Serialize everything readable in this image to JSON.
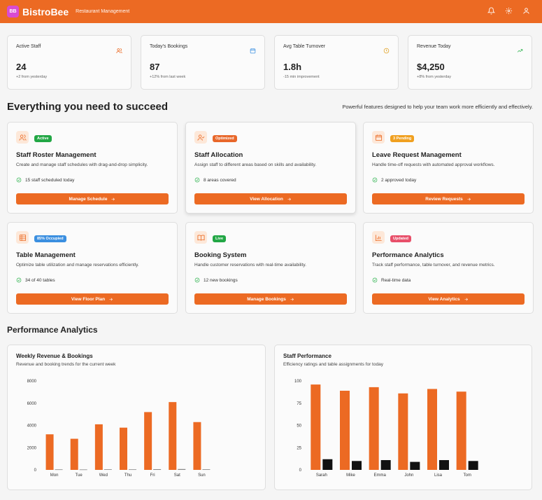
{
  "header": {
    "logo_initials": "BB",
    "brand": "BistroBee",
    "subtitle": "Restaurant Management",
    "icons": [
      "bell-icon",
      "gear-icon",
      "user-icon"
    ]
  },
  "stats": [
    {
      "label": "Active Staff",
      "value": "24",
      "delta": "+2 from yesterday",
      "icon": "users-icon",
      "icon_color": "#ec6a23"
    },
    {
      "label": "Today's Bookings",
      "value": "87",
      "delta": "+12% from last week",
      "icon": "calendar-icon",
      "icon_color": "#3b8fe0"
    },
    {
      "label": "Avg Table Turnover",
      "value": "1.8h",
      "delta": "-15 min improvement",
      "icon": "clock-icon",
      "icon_color": "#e0a020"
    },
    {
      "label": "Revenue Today",
      "value": "$4,250",
      "delta": "+8% from yesterday",
      "icon": "trending-up-icon",
      "icon_color": "#2bb24c"
    }
  ],
  "features_section": {
    "title": "Everything you need to succeed",
    "tagline": "Powerful features designed to help your team work more efficiently and effectively."
  },
  "features": [
    {
      "title": "Staff Roster Management",
      "desc": "Create and manage staff schedules with drag-and-drop simplicity.",
      "badge": "Active",
      "badge_color": "#22a745",
      "meta": "15 staff scheduled today",
      "button": "Manage Schedule",
      "icon": "users-icon"
    },
    {
      "title": "Staff Allocation",
      "desc": "Assign staff to different areas based on skills and availability.",
      "badge": "Optimized",
      "badge_color": "#e8672a",
      "meta": "8 areas covered",
      "button": "View Allocation",
      "icon": "user-check-icon"
    },
    {
      "title": "Leave Request Management",
      "desc": "Handle time-off requests with automated approval workflows.",
      "badge": "3 Pending",
      "badge_color": "#f0a020",
      "meta": "2 approved today",
      "button": "Review Requests",
      "icon": "calendar-icon"
    },
    {
      "title": "Table Management",
      "desc": "Optimize table utilization and manage reservations efficiently.",
      "badge": "85% Occupied",
      "badge_color": "#3b8fe0",
      "meta": "34 of 40 tables",
      "button": "View Floor Plan",
      "icon": "grid-icon"
    },
    {
      "title": "Booking System",
      "desc": "Handle customer reservations with real-time availability.",
      "badge": "Live",
      "badge_color": "#22a745",
      "meta": "12 new bookings",
      "button": "Manage Bookings",
      "icon": "book-icon"
    },
    {
      "title": "Performance Analytics",
      "desc": "Track staff performance, table turnover, and revenue metrics.",
      "badge": "Updated",
      "badge_color": "#e8506a",
      "meta": "Real-time data",
      "button": "View Analytics",
      "icon": "bar-chart-icon"
    }
  ],
  "analytics": {
    "title": "Performance Analytics"
  },
  "chart_data": [
    {
      "type": "bar",
      "title": "Weekly Revenue & Bookings",
      "subtitle": "Revenue and booking trends for the current week",
      "categories": [
        "Mon",
        "Tue",
        "Wed",
        "Thu",
        "Fri",
        "Sat",
        "Sun"
      ],
      "ylim": [
        0,
        8000
      ],
      "yticks": [
        0,
        2000,
        4000,
        6000,
        8000
      ],
      "grid": false,
      "series": [
        {
          "values": [
            3200,
            2800,
            4100,
            3800,
            5200,
            6100,
            4300
          ],
          "color": "#ec6a23"
        },
        {
          "values": [
            45,
            38,
            52,
            48,
            65,
            78,
            55
          ],
          "color": "#888888"
        }
      ]
    },
    {
      "type": "bar",
      "title": "Staff Performance",
      "subtitle": "Efficiency ratings and table assignments for today",
      "categories": [
        "Sarah",
        "Mike",
        "Emma",
        "John",
        "Lisa",
        "Tom"
      ],
      "ylim": [
        0,
        100
      ],
      "yticks": [
        0,
        25,
        50,
        75,
        100
      ],
      "grid": false,
      "series": [
        {
          "values": [
            96,
            89,
            93,
            86,
            91,
            88
          ],
          "color": "#ec6a23"
        },
        {
          "values": [
            12,
            10,
            11,
            9,
            11,
            10
          ],
          "color": "#111111"
        }
      ]
    }
  ]
}
